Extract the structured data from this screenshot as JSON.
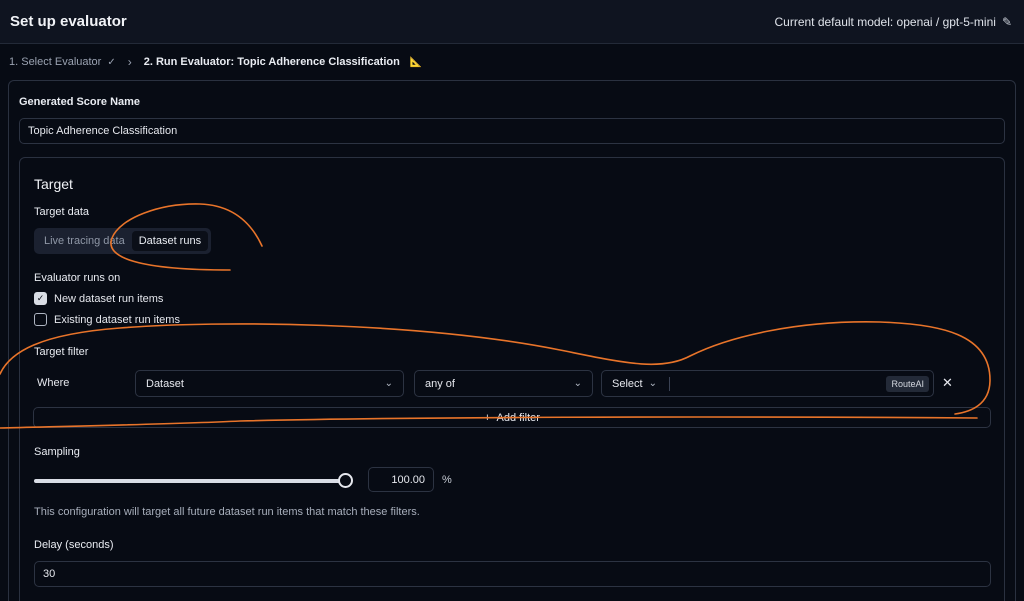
{
  "header": {
    "title": "Set up evaluator",
    "model_text": "Current default model: openai / gpt-5-mini",
    "edit_icon": "pencil-icon"
  },
  "breadcrumb": {
    "step1": "1. Select Evaluator",
    "step2": "2. Run Evaluator: Topic Adherence Classification"
  },
  "score_name": {
    "label": "Generated Score Name",
    "value": "Topic Adherence Classification"
  },
  "target": {
    "title": "Target",
    "data_label": "Target data",
    "options": [
      "Live tracing data",
      "Dataset runs"
    ],
    "selected": "Dataset runs",
    "runs_on_label": "Evaluator runs on",
    "checkbox_new": "New dataset run items",
    "checkbox_existing": "Existing dataset run items",
    "new_checked": true,
    "existing_checked": false,
    "filter_label": "Target filter",
    "filter": {
      "where": "Where",
      "column": "Dataset",
      "operator": "any of",
      "value_select": "Select",
      "value_chip": "RouteAI"
    },
    "add_filter": "Add filter"
  },
  "sampling": {
    "label": "Sampling",
    "value": "100.00",
    "unit": "%",
    "level_fraction": 1.0,
    "note": "This configuration will target all future dataset run items that match these filters."
  },
  "delay": {
    "label": "Delay (seconds)",
    "value": "30"
  },
  "colors": {
    "annotation": "#e8742a",
    "background": "#070b14"
  }
}
